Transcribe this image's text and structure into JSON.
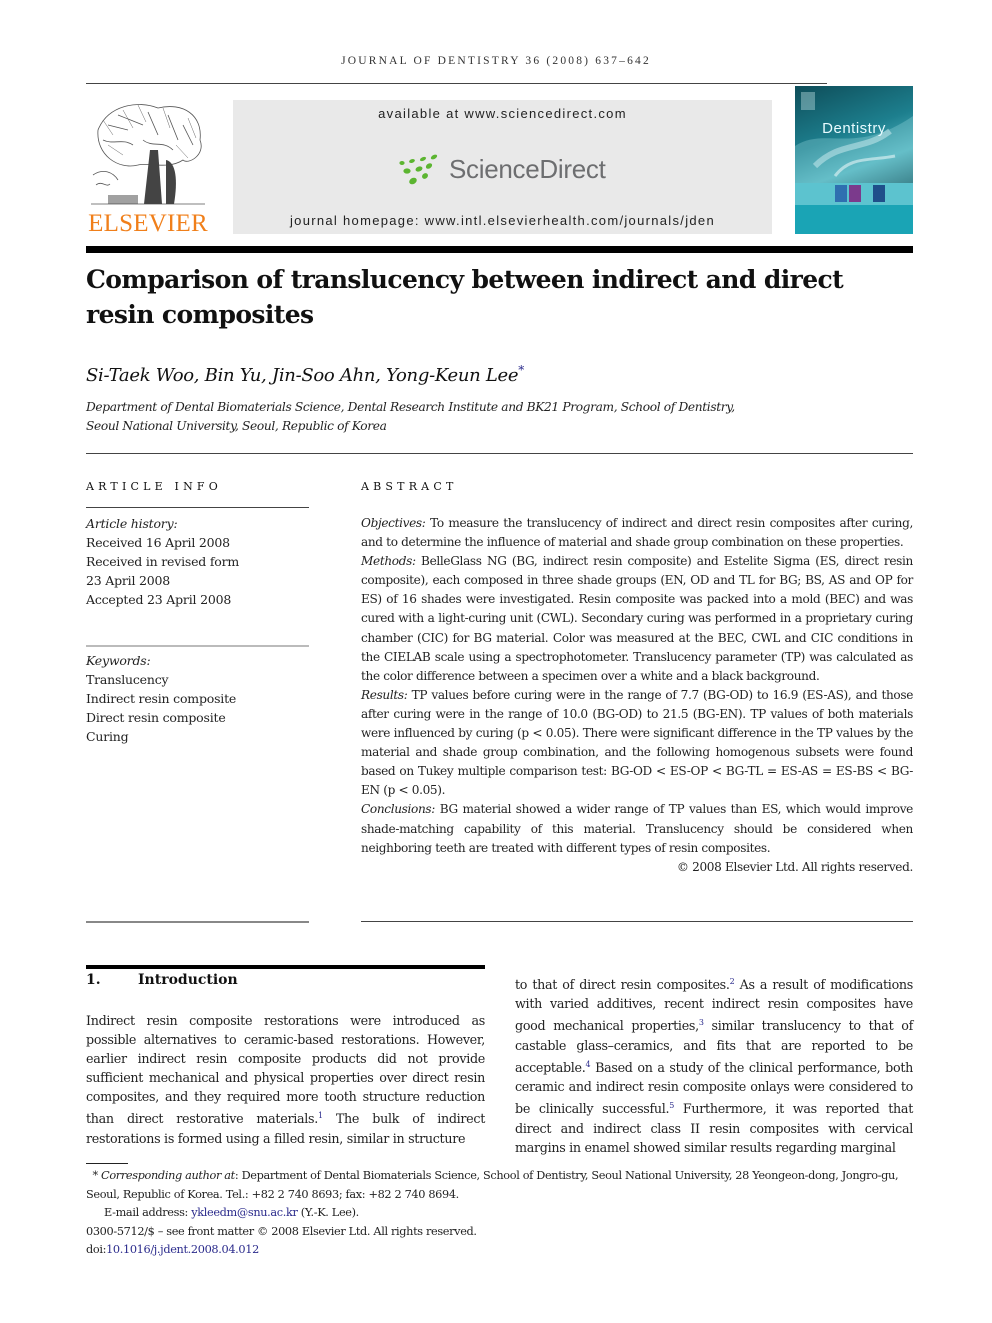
{
  "running_head": "JOURNAL OF DENTISTRY 36 (2008) 637–642",
  "header": {
    "publisher_name": "ELSEVIER",
    "sd_available": "available at www.sciencedirect.com",
    "sd_logo_text": "ScienceDirect",
    "sd_homepage": "journal homepage: www.intl.elsevierhealth.com/journals/jden",
    "cover_title": "Dentistry",
    "colors": {
      "elsevier_orange": "#f07f1a",
      "sd_green": "#5cb531",
      "sd_gray": "#6d6e70",
      "cover_teal": "#1aa4b5"
    }
  },
  "article": {
    "title": "Comparison of translucency between indirect and direct resin composites",
    "authors": "Si-Taek Woo, Bin Yu, Jin-Soo Ahn, Yong-Keun Lee",
    "author_mark": "*",
    "affiliation_line1": "Department of Dental Biomaterials Science, Dental Research Institute and BK21 Program, School of Dentistry,",
    "affiliation_line2": "Seoul National University, Seoul, Republic of Korea"
  },
  "article_info": {
    "heading": "ARTICLE INFO",
    "history_label": "Article history:",
    "history": [
      "Received 16 April 2008",
      "Received in revised form",
      "23 April 2008",
      "Accepted 23 April 2008"
    ],
    "keywords_label": "Keywords:",
    "keywords": [
      "Translucency",
      "Indirect resin composite",
      "Direct resin composite",
      "Curing"
    ]
  },
  "abstract": {
    "heading": "ABSTRACT",
    "objectives_label": "Objectives:",
    "objectives": " To measure the translucency of indirect and direct resin composites after curing, and to determine the influence of material and shade group combination on these properties.",
    "methods_label": "Methods:",
    "methods": " BelleGlass NG (BG, indirect resin composite) and Estelite Sigma (ES, direct resin composite), each composed in three shade groups (EN, OD and TL for BG; BS, AS and OP for ES) of 16 shades were investigated. Resin composite was packed into a mold (BEC) and was cured with a light-curing unit (CWL). Secondary curing was performed in a proprietary curing chamber (CIC) for BG material. Color was measured at the BEC, CWL and CIC conditions in the CIELAB scale using a spectrophotometer. Translucency parameter (TP) was calculated as the color difference between a specimen over a white and a black background.",
    "results_label": "Results:",
    "results": " TP values before curing were in the range of 7.7 (BG-OD) to 16.9 (ES-AS), and those after curing were in the range of 10.0 (BG-OD) to 21.5 (BG-EN). TP values of both materials were influenced by curing (p < 0.05). There were significant difference in the TP values by the material and shade group combination, and the following homogenous subsets were found based on Tukey multiple comparison test: BG-OD < ES-OP < BG-TL = ES-AS = ES-BS < BG-EN (p < 0.05).",
    "conclusions_label": "Conclusions:",
    "conclusions": " BG material showed a wider range of TP values than ES, which would improve shade-matching capability of this material. Translucency should be considered when neighboring teeth are treated with different types of resin composites.",
    "copyright": "© 2008 Elsevier Ltd. All rights reserved."
  },
  "introduction": {
    "number": "1.",
    "heading": "Introduction",
    "left_a": "Indirect resin composite restorations were introduced as possible alternatives to ceramic-based restorations. However, earlier indirect resin composite products did not provide sufficient mechanical and physical properties over direct resin composites, and they required more tooth structure reduction than direct restorative materials.",
    "ref1": "1",
    "left_b": " The bulk of indirect restorations is formed using a filled resin, similar in structure",
    "right_a": "to that of direct resin composites.",
    "ref2": "2",
    "right_b": " As a result of modifications with varied additives, recent indirect resin composites have good mechanical properties,",
    "ref3": "3",
    "right_c": " similar translucency to that of castable glass–ceramics, and fits that are reported to be acceptable.",
    "ref4": "4",
    "right_d": " Based on a study of the clinical performance, both ceramic and indirect resin composite onlays were considered to be clinically successful.",
    "ref5": "5",
    "right_e": " Furthermore, it was reported that direct and indirect class II resin composites with cervical margins in enamel showed similar results regarding marginal"
  },
  "footnotes": {
    "star": "*",
    "corr_label": "Corresponding author at",
    "corr_text": ": Department of Dental Biomaterials Science, School of Dentistry, Seoul National University, 28 Yeongeon-dong, Jongro-gu, Seoul, Republic of Korea. Tel.: +82 2 740 8693; fax: +82 2 740 8694.",
    "email_label": "E-mail address: ",
    "email": "ykleedm@snu.ac.kr",
    "email_suffix": " (Y.-K. Lee).",
    "front_matter": "0300-5712/$ – see front matter © 2008 Elsevier Ltd. All rights reserved.",
    "doi_label": "doi:",
    "doi": "10.1016/j.jdent.2008.04.012"
  }
}
